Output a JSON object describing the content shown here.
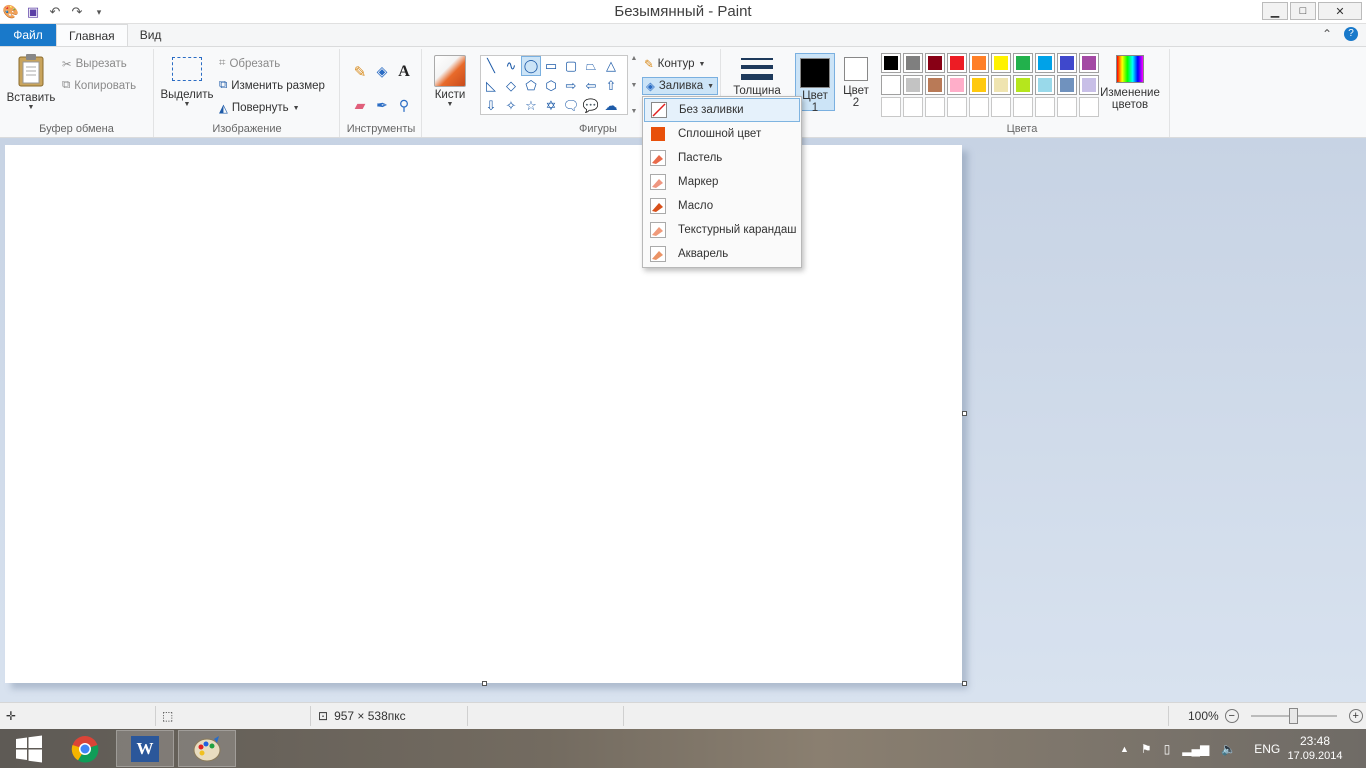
{
  "window": {
    "title": "Безымянный - Paint",
    "controls": {
      "minimize": "▁",
      "maximize": "□",
      "close": "✕"
    }
  },
  "quick_access": [
    "paint-app-icon",
    "save-icon",
    "undo-icon",
    "redo-icon",
    "customize-icon"
  ],
  "tabs": [
    {
      "label": "Файл"
    },
    {
      "label": "Главная"
    },
    {
      "label": "Вид"
    }
  ],
  "ribbon": {
    "clipboard": {
      "paste": "Вставить",
      "cut": "Вырезать",
      "copy": "Копировать",
      "group": "Буфер обмена"
    },
    "image": {
      "select": "Выделить",
      "crop": "Обрезать",
      "resize": "Изменить размер",
      "rotate": "Повернуть",
      "group": "Изображение"
    },
    "tools": {
      "group": "Инструменты",
      "items": [
        "pencil-icon",
        "fill-bucket-icon",
        "text-icon",
        "eraser-icon",
        "color-picker-icon",
        "magnifier-icon"
      ]
    },
    "brushes": {
      "label": "Кисти"
    },
    "shapes": {
      "group": "Фигуры",
      "outline": "Контур",
      "fill": "Заливка",
      "glyphs": [
        "╲",
        "∿",
        "◯",
        "▭",
        "▢",
        "⏢",
        "△",
        "◺",
        "◇",
        "⬠",
        "⬡",
        "⇨",
        "⇦",
        "⇧",
        "⇩",
        "✧",
        "☆",
        "✡",
        "🗨",
        "💬",
        "☁"
      ]
    },
    "size": {
      "label": "Толщина"
    },
    "color1": {
      "label": "Цвет 1",
      "color": "#000000"
    },
    "color2": {
      "label": "Цвет 2",
      "color": "#ffffff"
    },
    "colors": {
      "group": "Цвета",
      "edit": "Изменение цветов",
      "row1": [
        "#000000",
        "#7f7f7f",
        "#880015",
        "#ed1c24",
        "#ff7f27",
        "#fff200",
        "#22b14c",
        "#00a2e8",
        "#3f48cc",
        "#a349a4"
      ],
      "row2": [
        "#ffffff",
        "#c3c3c3",
        "#b97a57",
        "#ffaec9",
        "#ffc90e",
        "#efe4b0",
        "#b5e61d",
        "#99d9ea",
        "#7092be",
        "#c8bfe7"
      ]
    }
  },
  "fill_menu": {
    "items": [
      {
        "label": "Без заливки"
      },
      {
        "label": "Сплошной цвет"
      },
      {
        "label": "Пастель"
      },
      {
        "label": "Маркер"
      },
      {
        "label": "Масло"
      },
      {
        "label": "Текстурный карандаш"
      },
      {
        "label": "Акварель"
      }
    ]
  },
  "status": {
    "canvas_size": "957 × 538пкс",
    "zoom": "100%",
    "zoom_level": 0.5
  },
  "taskbar": {
    "lang": "ENG",
    "time": "23:48",
    "date": "17.09.2014"
  }
}
